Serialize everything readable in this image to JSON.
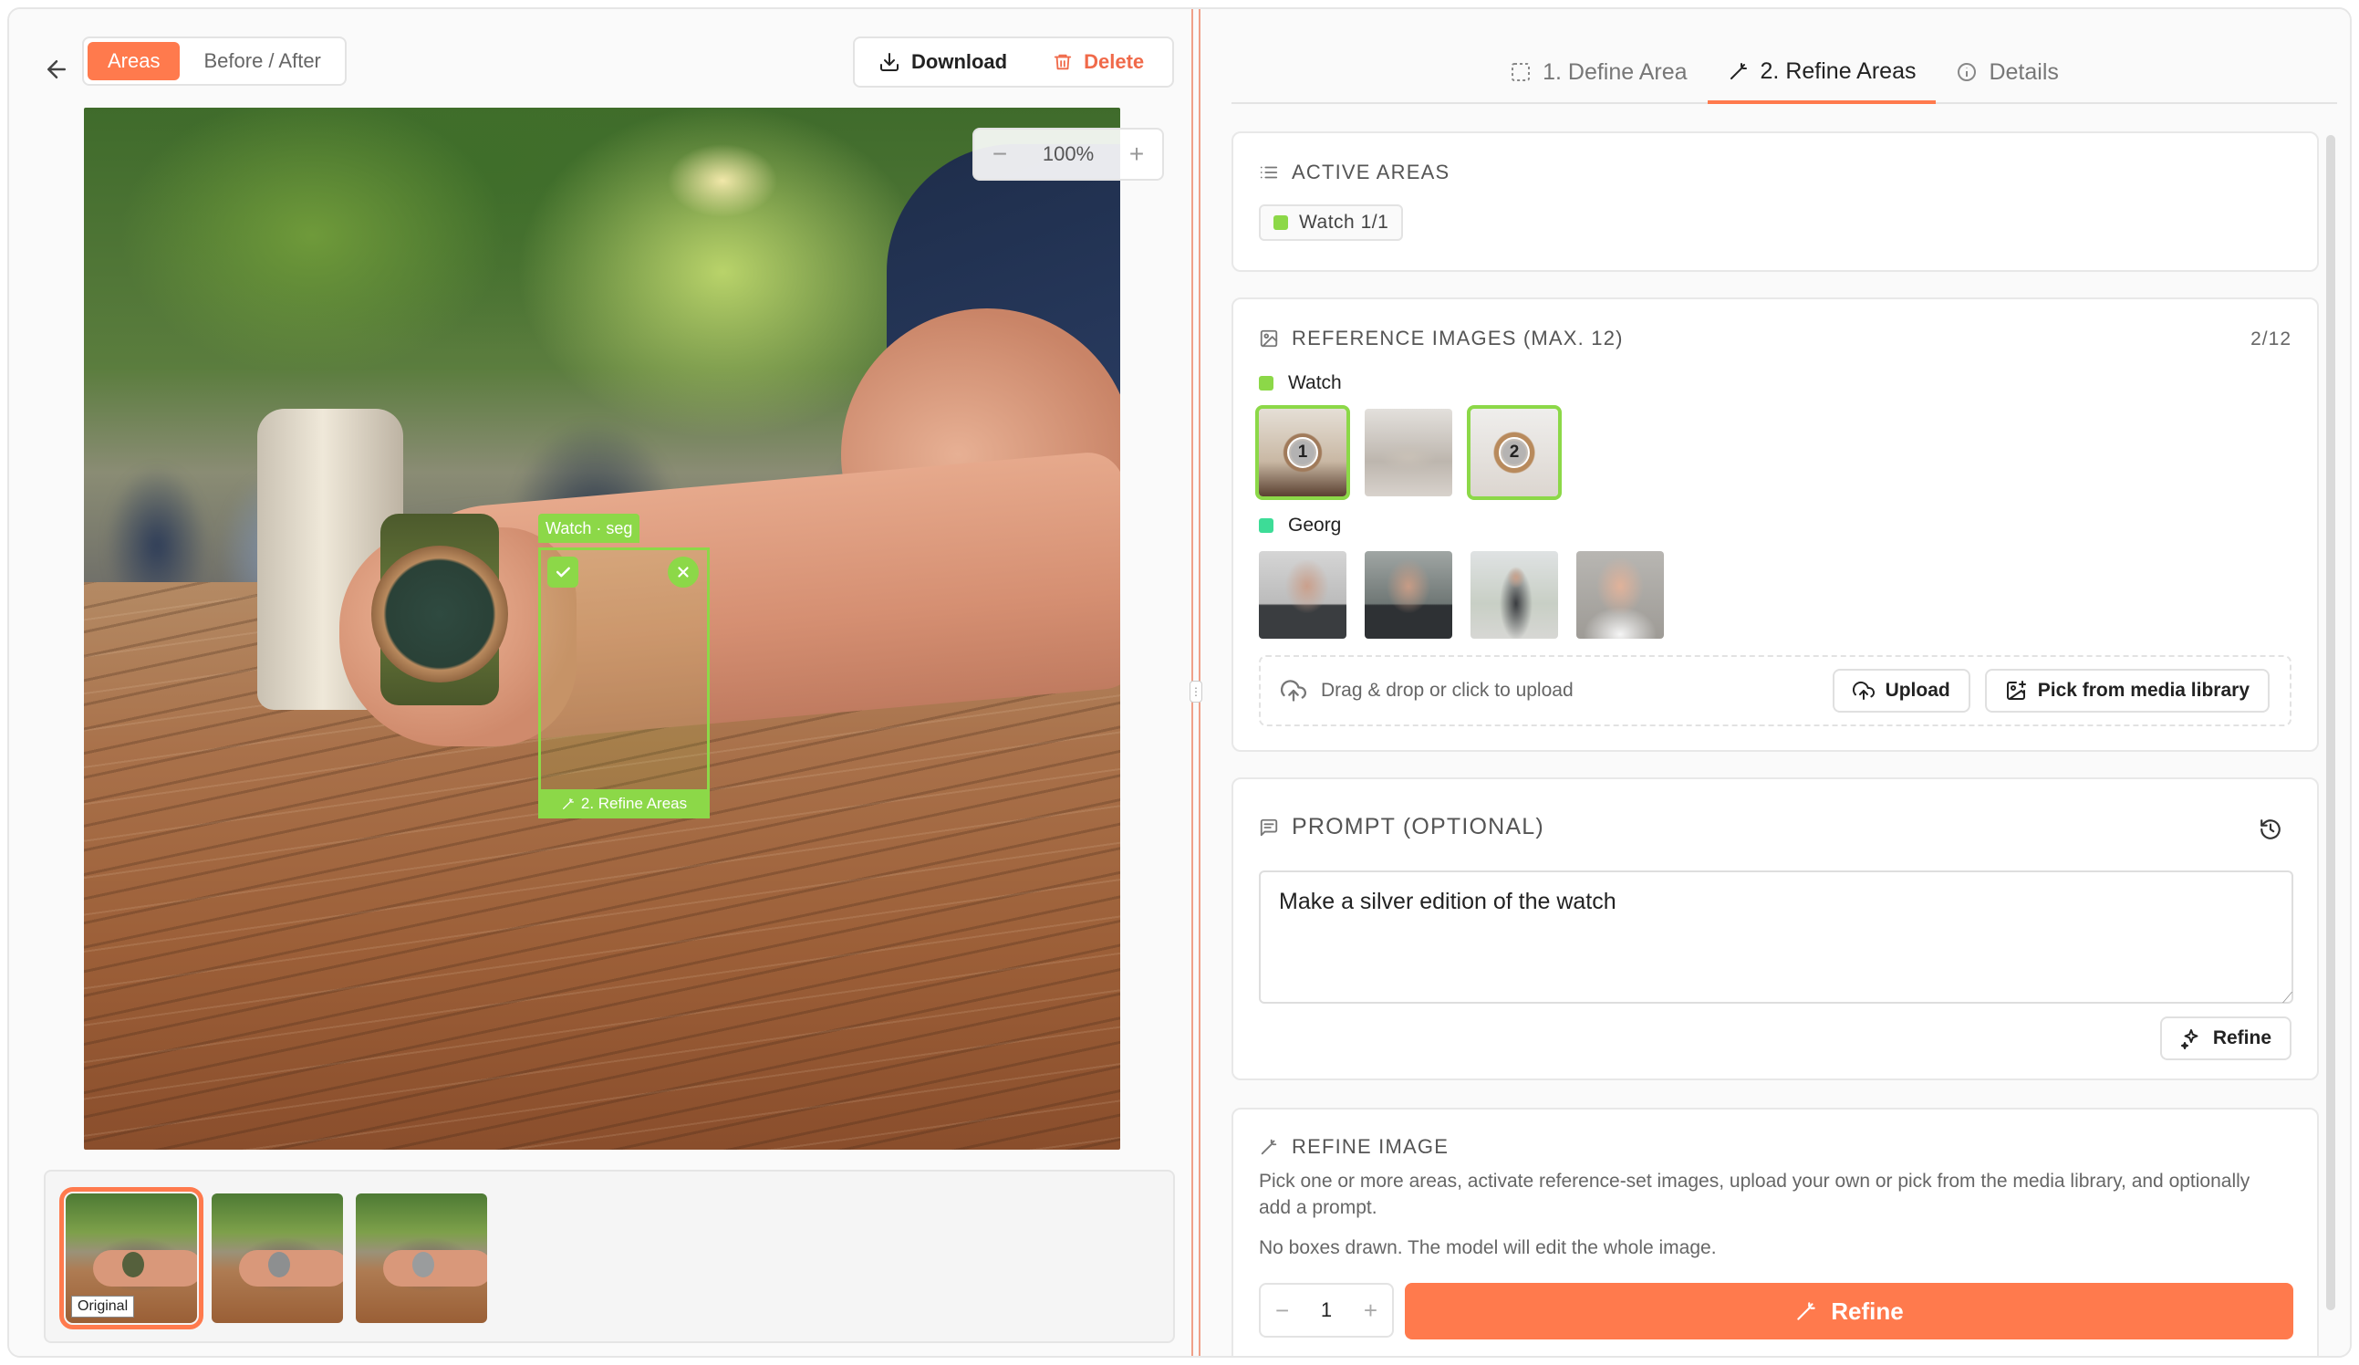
{
  "toolbar": {
    "view_modes": [
      "Areas",
      "Before / After"
    ],
    "active_view": "Areas",
    "download_label": "Download",
    "delete_label": "Delete"
  },
  "canvas": {
    "zoom": "100%",
    "zoom_minus": "−",
    "zoom_plus": "+",
    "box_label": "Watch · seg",
    "box_action": "2. Refine Areas"
  },
  "thumbnails": [
    {
      "label": "Original",
      "selected": true
    },
    {
      "label": "",
      "selected": false
    },
    {
      "label": "",
      "selected": false
    }
  ],
  "tabs": [
    {
      "label": "1. Define Area",
      "icon": "dashed-square-icon",
      "active": false
    },
    {
      "label": "2. Refine Areas",
      "icon": "magic-wand-icon",
      "active": true
    },
    {
      "label": "Details",
      "icon": "info-icon",
      "active": false
    }
  ],
  "active_areas": {
    "title": "ACTIVE AREAS",
    "chips": [
      {
        "label": "Watch 1/1",
        "color": "#8cd848"
      }
    ]
  },
  "reference_images": {
    "title": "REFERENCE IMAGES (MAX. 12)",
    "count": "2/12",
    "groups": [
      {
        "name": "Watch",
        "color": "#8cd848",
        "images": [
          {
            "badge": "1",
            "selected": true
          },
          {
            "badge": "",
            "selected": false
          },
          {
            "badge": "2",
            "selected": true
          }
        ]
      },
      {
        "name": "Georg",
        "color": "#3ddc97",
        "images": [
          {
            "badge": "",
            "selected": false
          },
          {
            "badge": "",
            "selected": false
          },
          {
            "badge": "",
            "selected": false
          },
          {
            "badge": "",
            "selected": false
          }
        ]
      }
    ],
    "upload_hint": "Drag & drop or click to upload",
    "upload_label": "Upload",
    "media_label": "Pick from media library"
  },
  "prompt": {
    "title": "PROMPT (OPTIONAL)",
    "value": "Make a silver edition of the watch",
    "refine_label": "Refine"
  },
  "refine_image": {
    "title": "REFINE IMAGE",
    "description": "Pick one or more areas, activate reference-set images, upload your own or pick from the media library, and optionally add a prompt.",
    "note": "No boxes drawn. The model will edit the whole image.",
    "count": "1",
    "button_label": "Refine"
  },
  "colors": {
    "accent": "#ff7a4d",
    "area_watch": "#8cd848",
    "area_georg": "#3ddc97",
    "danger": "#f06a4a"
  }
}
